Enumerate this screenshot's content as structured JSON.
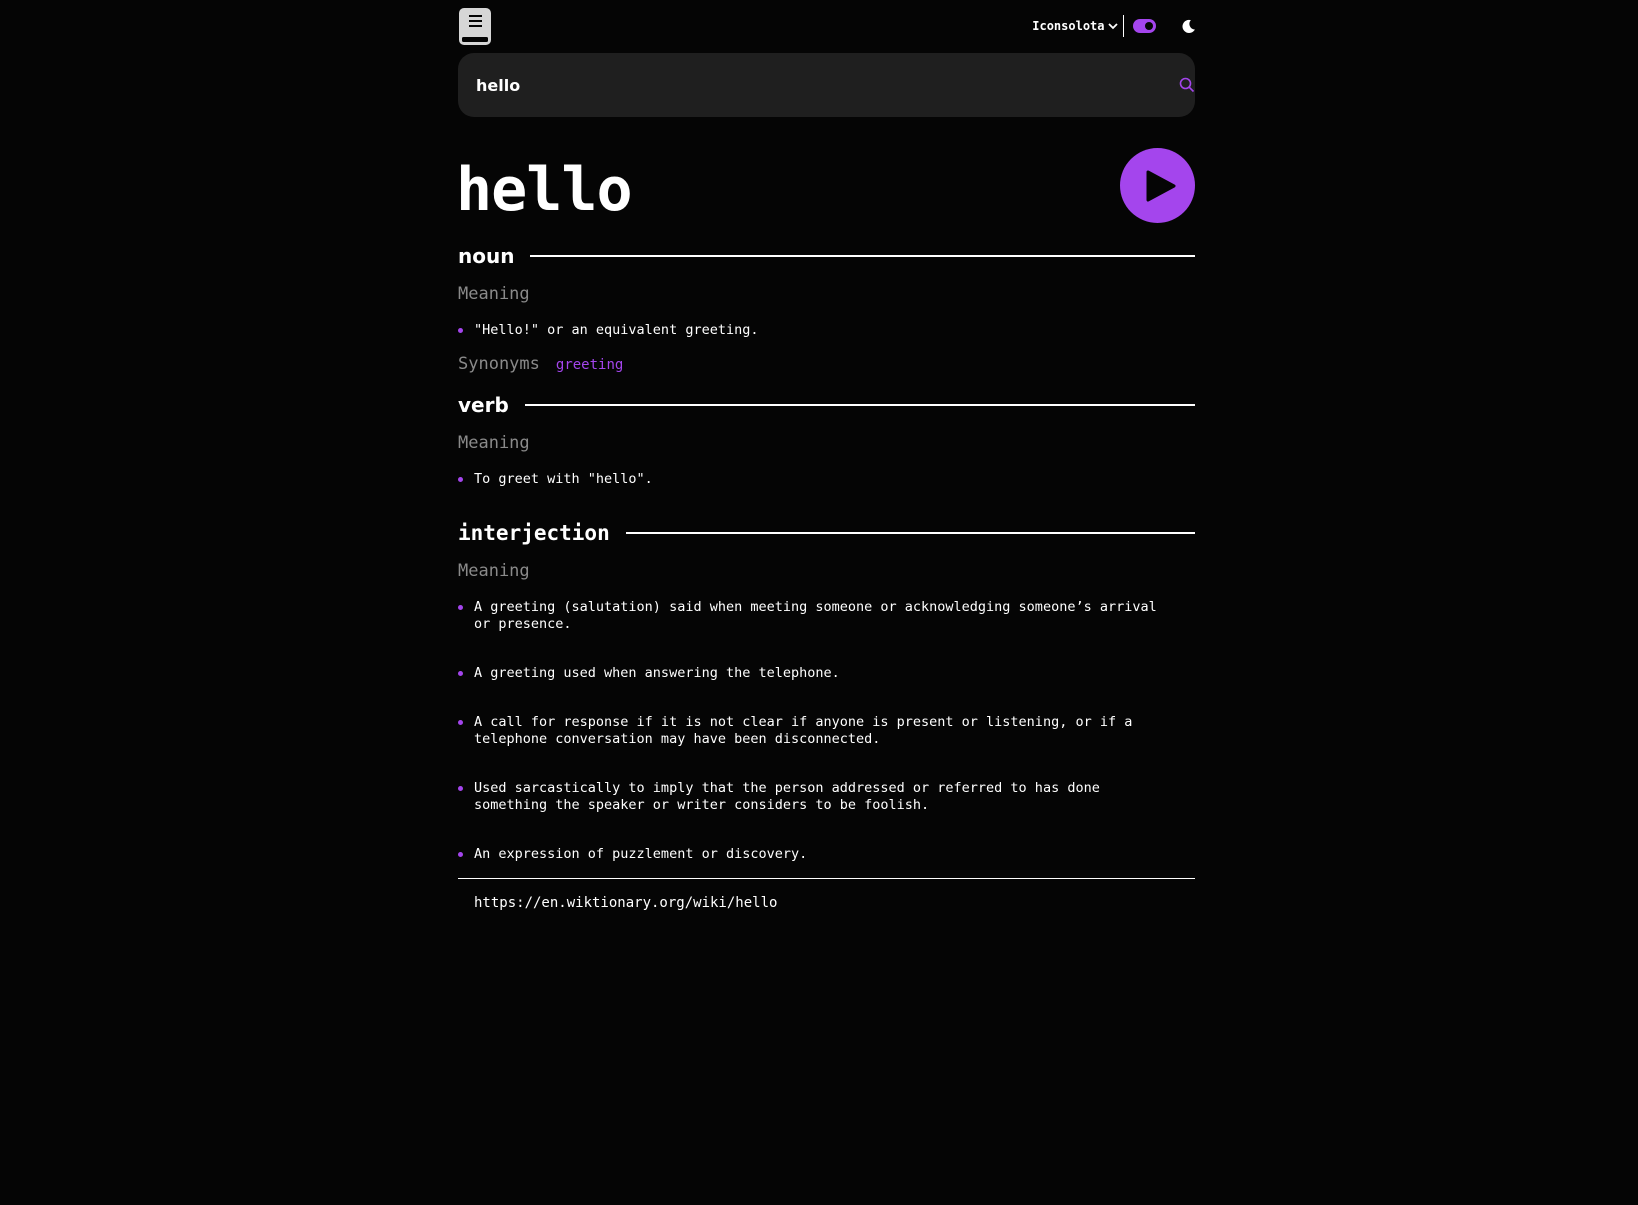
{
  "header": {
    "font_selector": "Iconsolota",
    "logo_icon": "book-icon",
    "theme_icon": "moon-icon",
    "theme_toggle_on": true
  },
  "search": {
    "value": "hello",
    "icon": "search-icon"
  },
  "word": "hello",
  "play_icon": "play-icon",
  "accent_color": "#a445ed",
  "meanings": [
    {
      "part_of_speech": "noun",
      "meaning_label": "Meaning",
      "definitions": [
        "\"Hello!\" or an equivalent greeting."
      ],
      "synonyms_label": "Synonyms",
      "synonyms": [
        "greeting"
      ]
    },
    {
      "part_of_speech": "verb",
      "meaning_label": "Meaning",
      "definitions": [
        "To greet with \"hello\"."
      ]
    },
    {
      "part_of_speech": "interjection",
      "meaning_label": "Meaning",
      "definitions": [
        "A greeting (salutation) said when meeting someone or acknowledging someone’s arrival or presence.",
        "A greeting used when answering the telephone.",
        "A call for response if it is not clear if anyone is present or listening, or if a telephone conversation may have been disconnected.",
        "Used sarcastically to imply that the person addressed or referred to has done something the speaker or writer considers to be foolish.",
        "An expression of puzzlement or discovery."
      ]
    }
  ],
  "source_url": "https://en.wiktionary.org/wiki/hello"
}
